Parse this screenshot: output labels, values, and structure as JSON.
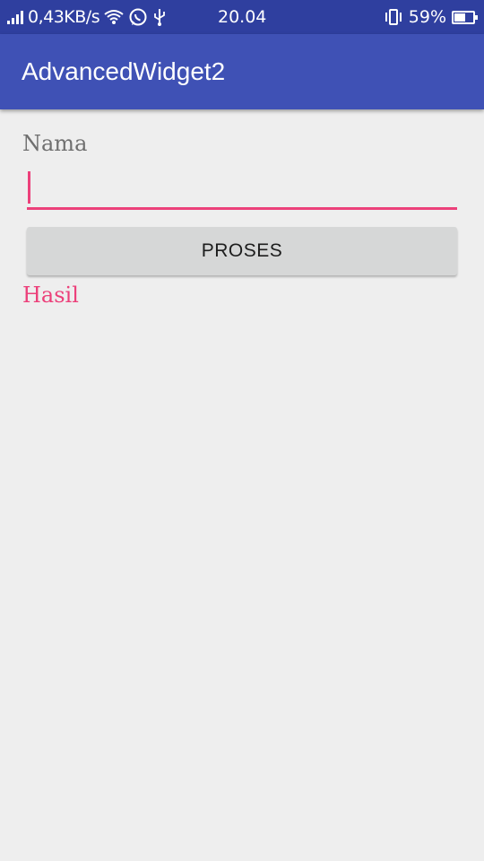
{
  "status_bar": {
    "net_speed": "0,43KB/s",
    "time": "20.04",
    "battery_percent": "59%",
    "battery_level": 0.59,
    "icons": [
      "signal-icon",
      "wifi-icon",
      "whatsapp-icon",
      "usb-icon",
      "vibrate-icon",
      "battery-icon"
    ]
  },
  "app_bar": {
    "title": "AdvancedWidget2"
  },
  "form": {
    "name_label": "Nama",
    "name_value": "",
    "proses_label": "PROSES",
    "result_label": "Hasil"
  },
  "colors": {
    "status_bar": "#2f3f9f",
    "app_bar": "#3f51b5",
    "accent": "#ec407a",
    "background": "#eeeeee",
    "button": "#d6d7d7"
  }
}
